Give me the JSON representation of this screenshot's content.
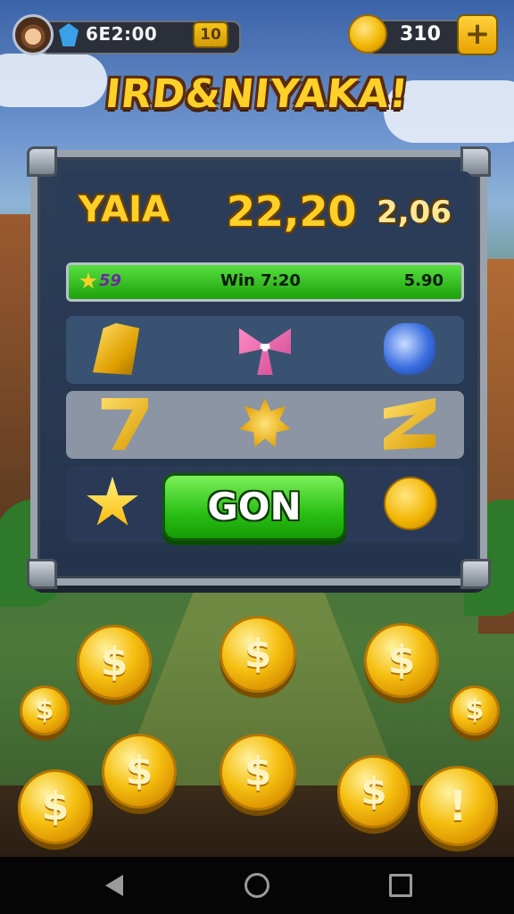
{
  "hud": {
    "avatar_icon": "explorer-avatar",
    "gem_icon": "blue-gem-icon",
    "time": "6E2:00",
    "level": "10",
    "coin_icon": "gold-coin-icon",
    "coins": "310",
    "add_label": "+"
  },
  "title": "IRD&NIYAKA!",
  "panel": {
    "player_name": "YAIA",
    "score": "22,20",
    "score_extra": "2,06",
    "progress": {
      "left_text": "59",
      "mid_text": "Win 7:20",
      "right_text": "5.90",
      "fill_fraction": 1.0
    },
    "row1_icons": [
      "gold-bars-icon",
      "pink-bow-icon",
      "blue-gem-icon"
    ],
    "row2_icons": [
      "gold-seven-icon",
      "sun-star-icon",
      "gold-z-icon"
    ],
    "row3_icons": [
      "big-star-icon",
      "gold-coin-icon"
    ],
    "go_label": "GON"
  },
  "coins": [
    "$",
    "$",
    "$",
    "$",
    "$",
    "$",
    "$",
    "$",
    "$",
    "!"
  ],
  "colors": {
    "accent_gold": "#ffd028",
    "go_green": "#2ac014",
    "panel_bg": "#2d3e58"
  },
  "navbar": {
    "back_icon": "back-triangle-icon",
    "home_icon": "home-circle-icon",
    "recent_icon": "recent-square-icon"
  }
}
